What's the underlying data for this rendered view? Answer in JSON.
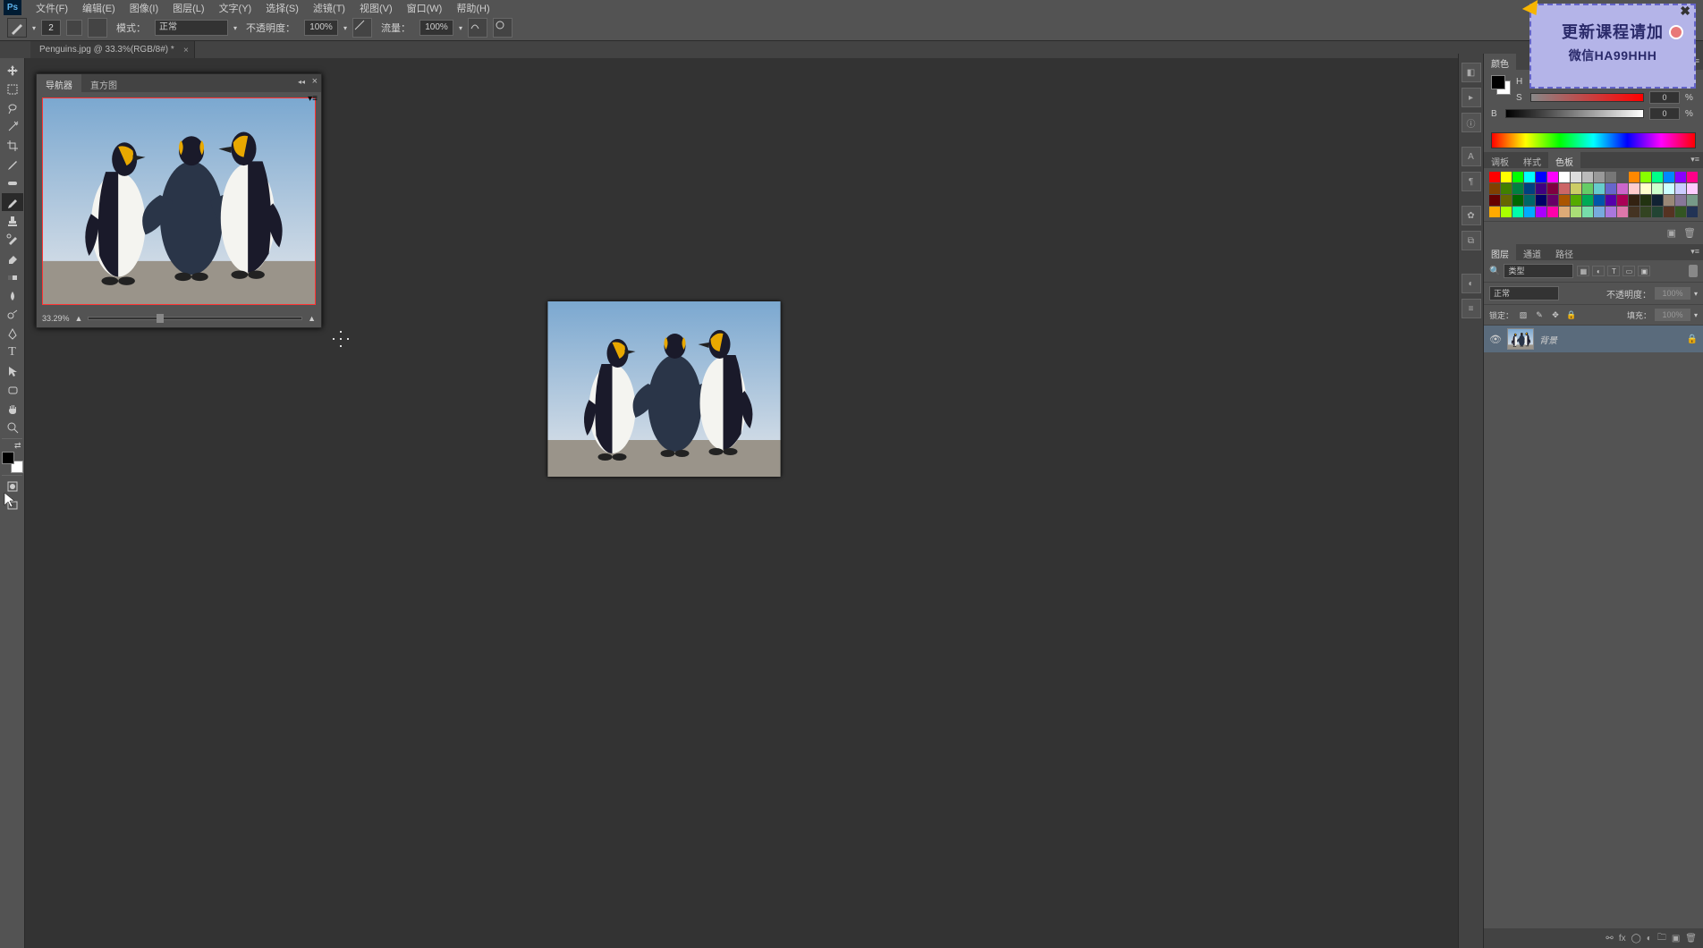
{
  "app": {
    "name": "Ps"
  },
  "menu": [
    "文件(F)",
    "编辑(E)",
    "图像(I)",
    "图层(L)",
    "文字(Y)",
    "选择(S)",
    "滤镜(T)",
    "视图(V)",
    "窗口(W)",
    "帮助(H)"
  ],
  "options": {
    "brush_size": "2",
    "mode_label": "模式：",
    "mode_value": "正常",
    "opacity_label": "不透明度：",
    "opacity_value": "100%",
    "flow_label": "流量：",
    "flow_value": "100%"
  },
  "document": {
    "tab": "Penguins.jpg @ 33.3%(RGB/8#) *"
  },
  "navigator": {
    "tab1": "导航器",
    "tab2": "直方图",
    "zoom": "33.29%"
  },
  "color": {
    "tab": "颜色",
    "h_label": "H",
    "s_label": "S",
    "b_label": "B",
    "h_val": "",
    "s_val": "0",
    "b_val": "0",
    "h_unit": "°",
    "s_unit": "%",
    "b_unit": "%"
  },
  "swatches_tabs": {
    "t1": "调板",
    "t2": "样式",
    "t3": "色板"
  },
  "swatch_colors": [
    "#ff0000",
    "#ffff00",
    "#00ff00",
    "#00ffff",
    "#0000ff",
    "#ff00ff",
    "#ffffff",
    "#dddddd",
    "#bbbbbb",
    "#999999",
    "#777777",
    "#555555",
    "#ff8800",
    "#88ff00",
    "#00ff88",
    "#0088ff",
    "#8800ff",
    "#ff0088",
    "#804000",
    "#408000",
    "#008040",
    "#004080",
    "#400080",
    "#800040",
    "#cc6666",
    "#cccc66",
    "#66cc66",
    "#66cccc",
    "#6666cc",
    "#cc66cc",
    "#ffcccc",
    "#ffffcc",
    "#ccffcc",
    "#ccffff",
    "#ccccff",
    "#ffccff",
    "#660000",
    "#666600",
    "#006600",
    "#006666",
    "#000066",
    "#660066",
    "#aa5500",
    "#55aa00",
    "#00aa55",
    "#0055aa",
    "#5500aa",
    "#aa0055",
    "#332211",
    "#223311",
    "#112233",
    "#998877",
    "#887799",
    "#779988",
    "#ffaa00",
    "#aaff00",
    "#00ffaa",
    "#00aaff",
    "#aa00ff",
    "#ff00aa",
    "#ddaa77",
    "#aadd77",
    "#77ddaa",
    "#77aadd",
    "#aa77dd",
    "#dd77aa",
    "#443322",
    "#334422",
    "#224433",
    "#553322",
    "#335522",
    "#223355"
  ],
  "layers": {
    "tab1": "图层",
    "tab2": "通道",
    "tab3": "路径",
    "kind_label": "类型",
    "blend": "正常",
    "opacity_label": "不透明度：",
    "opacity_val": "100%",
    "lock_label": "锁定：",
    "fill_label": "填充：",
    "fill_val": "100%",
    "bg_name": "背景"
  },
  "overlay": {
    "line1": "更新课程请加",
    "line2": "微信HA99HHH"
  }
}
